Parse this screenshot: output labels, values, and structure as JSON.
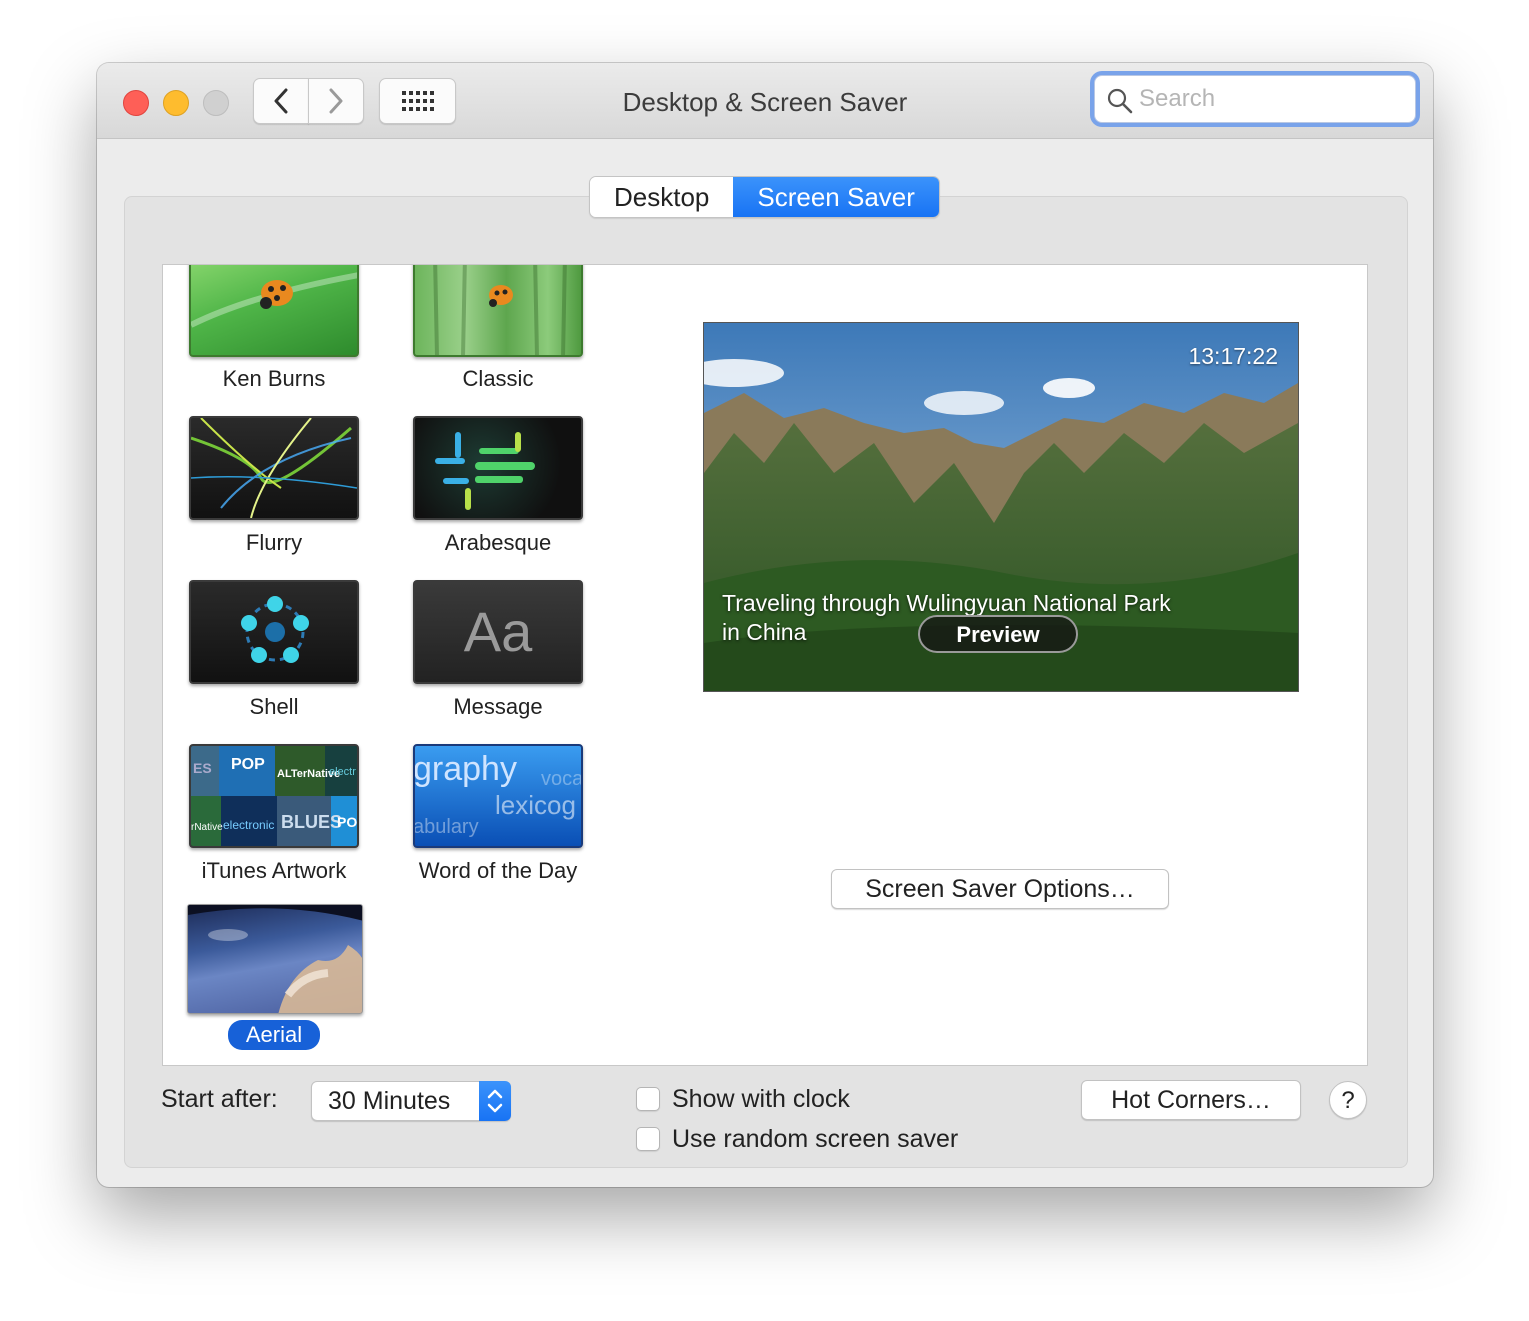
{
  "window": {
    "title": "Desktop & Screen Saver",
    "search_placeholder": "Search"
  },
  "tabs": [
    {
      "label": "Desktop",
      "active": false
    },
    {
      "label": "Screen Saver",
      "active": true
    }
  ],
  "savers": [
    {
      "label": "Ken Burns",
      "thumb": "ladybug-green"
    },
    {
      "label": "Classic",
      "thumb": "ladybug-forest"
    },
    {
      "label": "Flurry",
      "thumb": "flurry"
    },
    {
      "label": "Arabesque",
      "thumb": "arabesque"
    },
    {
      "label": "Shell",
      "thumb": "shell"
    },
    {
      "label": "Message",
      "thumb": "message",
      "glyph": "Aa"
    },
    {
      "label": "iTunes Artwork",
      "thumb": "itunes-artwork"
    },
    {
      "label": "Word of the Day",
      "thumb": "word-of-the-day",
      "words": [
        "graphy",
        "voca",
        "lexicog",
        "abulary"
      ]
    },
    {
      "label": "Aerial",
      "thumb": "aerial",
      "selected": true
    }
  ],
  "itunes_thumb_words": [
    "ES",
    "POP",
    "ALTerNative",
    "electr",
    "rNative",
    "electronic",
    "BLUES",
    "PO"
  ],
  "preview": {
    "clock": "13:17:22",
    "caption_line1": "Traveling through Wulingyuan National Park",
    "caption_line2": "in China",
    "button": "Preview"
  },
  "options_button": "Screen Saver Options…",
  "start_after": {
    "label": "Start after:",
    "value": "30 Minutes"
  },
  "checkboxes": {
    "show_clock": {
      "label": "Show with clock",
      "checked": false
    },
    "random": {
      "label": "Use random screen saver",
      "checked": false
    }
  },
  "hot_corners_button": "Hot Corners…",
  "help_button": "?",
  "colors": {
    "accent": "#1873f4",
    "selection": "#1761d8"
  }
}
